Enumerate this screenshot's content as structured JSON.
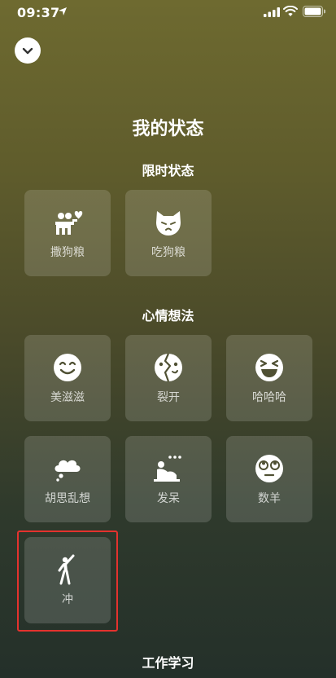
{
  "status_bar": {
    "time": "09:37",
    "icons": [
      "location-arrow-icon",
      "cellular-signal-icon",
      "wifi-icon",
      "battery-icon"
    ]
  },
  "header": {
    "collapse_icon": "chevron-down-icon",
    "title": "我的状态"
  },
  "sections": [
    {
      "title": "限时状态",
      "items": [
        {
          "label": "撒狗粮",
          "icon": "couple-heart-icon"
        },
        {
          "label": "吃狗粮",
          "icon": "cat-face-icon"
        }
      ]
    },
    {
      "title": "心情想法",
      "items": [
        {
          "label": "美滋滋",
          "icon": "smile-face-icon"
        },
        {
          "label": "裂开",
          "icon": "cracked-face-icon"
        },
        {
          "label": "哈哈哈",
          "icon": "laughing-face-icon"
        },
        {
          "label": "胡思乱想",
          "icon": "thought-cloud-icon"
        },
        {
          "label": "发呆",
          "icon": "daze-person-icon"
        },
        {
          "label": "数羊",
          "icon": "rolling-eyes-face-icon"
        },
        {
          "label": "冲",
          "icon": "cheering-person-icon",
          "highlighted": true
        }
      ]
    },
    {
      "title": "工作学习",
      "items": []
    }
  ],
  "colors": {
    "highlight_border": "#e4322e",
    "tile_bg": "rgba(255,255,255,0.15)",
    "background_top": "#6e6a30",
    "background_bottom": "#24302a"
  }
}
